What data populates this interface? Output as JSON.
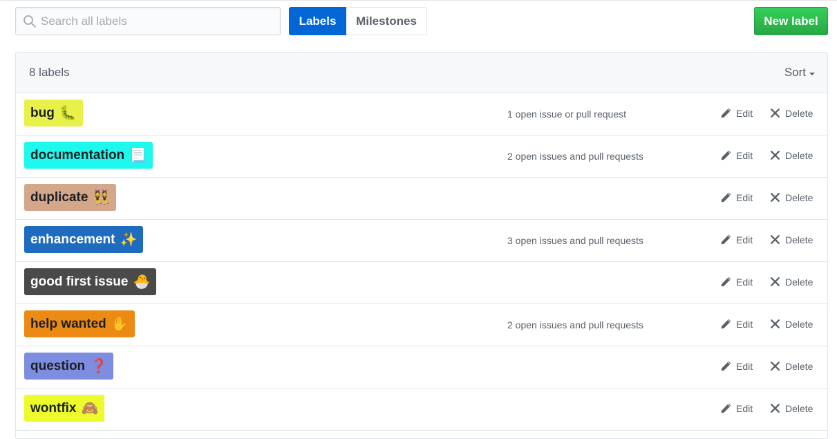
{
  "search": {
    "placeholder": "Search all labels",
    "value": ""
  },
  "tabs": [
    {
      "label": "Labels",
      "active": true
    },
    {
      "label": "Milestones",
      "active": false
    }
  ],
  "new_label_button": "New label",
  "header": {
    "count": "8 labels",
    "sort": "Sort"
  },
  "actions": {
    "edit": "Edit",
    "delete": "Delete"
  },
  "labels": [
    {
      "name": "bug",
      "emoji": "🐛",
      "color": "#e8f04a",
      "text_color": "#1b1f23",
      "issues": "1 open issue or pull request"
    },
    {
      "name": "documentation",
      "emoji": "📃",
      "color": "#1ff8ec",
      "text_color": "#1b1f23",
      "issues": "2 open issues and pull requests"
    },
    {
      "name": "duplicate",
      "emoji": "👯",
      "color": "#d4a78a",
      "text_color": "#1b1f23",
      "issues": ""
    },
    {
      "name": "enhancement",
      "emoji": "✨",
      "color": "#1f6bbf",
      "text_color": "#ffffff",
      "issues": "3 open issues and pull requests"
    },
    {
      "name": "good first issue",
      "emoji": "🐣",
      "color": "#4a4a4a",
      "text_color": "#ffffff",
      "issues": ""
    },
    {
      "name": "help wanted",
      "emoji": "✋",
      "color": "#ec8a14",
      "text_color": "#1b1f23",
      "issues": "2 open issues and pull requests"
    },
    {
      "name": "question",
      "emoji": "❓",
      "color": "#7d8ee0",
      "text_color": "#1b1f23",
      "issues": ""
    },
    {
      "name": "wontfix",
      "emoji": "🙈",
      "color": "#ecfb2a",
      "text_color": "#1b1f23",
      "issues": ""
    }
  ],
  "colors": {
    "primary": "#0366d6",
    "success": "#28a745",
    "muted": "#586069",
    "border": "#e1e4e8"
  }
}
